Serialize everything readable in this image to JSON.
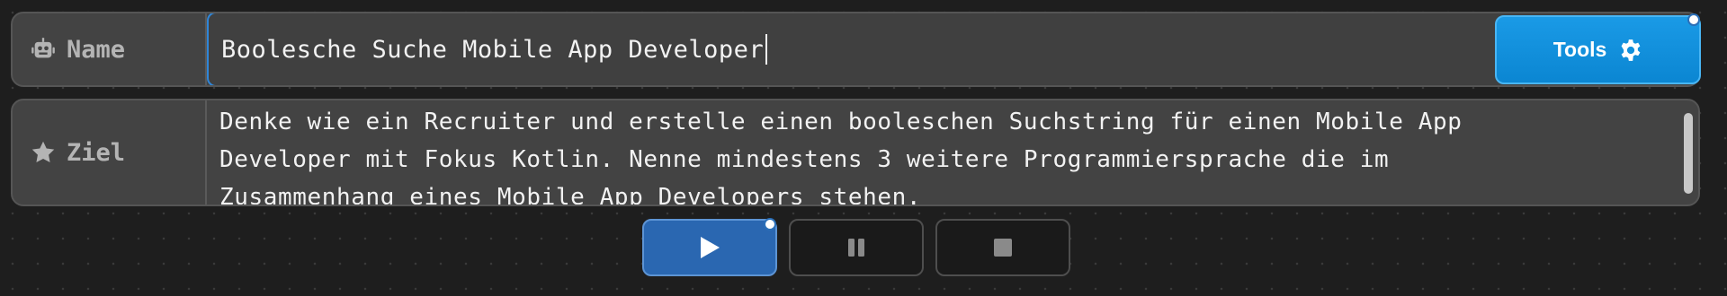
{
  "name_row": {
    "label": "Name",
    "icon": "robot-icon",
    "value": "Boolesche Suche Mobile App Developer"
  },
  "goal_row": {
    "label": "Ziel",
    "icon": "star-icon",
    "value": "Denke wie ein Recruiter und erstelle einen booleschen Suchstring für einen Mobile App\nDeveloper mit Fokus Kotlin. Nenne mindestens 3 weitere Programmiersprache die im\nZusammenhang eines Mobile App Developers stehen."
  },
  "tools_button": {
    "label": "Tools",
    "icon": "gear-icon"
  },
  "controls": {
    "play_icon": "play-icon",
    "pause_icon": "pause-icon",
    "stop_icon": "stop-icon"
  },
  "colors": {
    "accent": "#0b86d2",
    "play": "#2a67b1",
    "focus_border": "#2f86d9"
  }
}
